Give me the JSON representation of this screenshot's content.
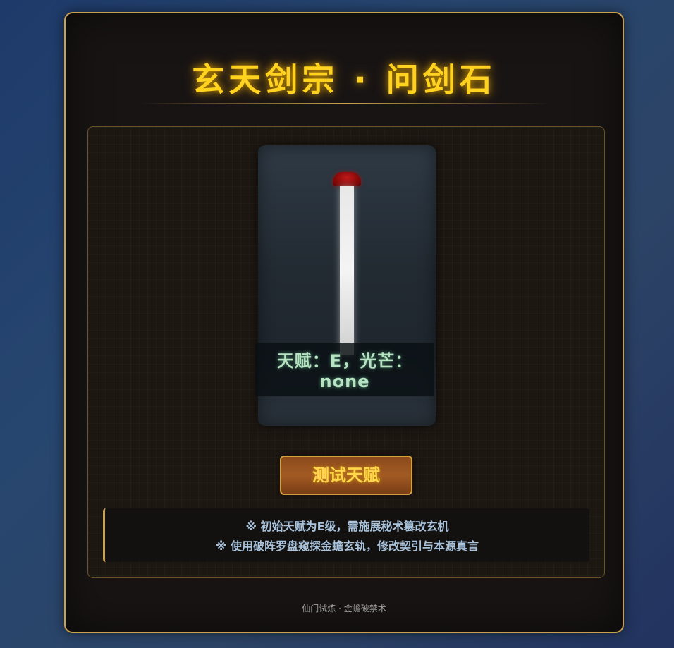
{
  "header": {
    "title": "玄天剑宗 · 问剑石"
  },
  "stone": {
    "readout_line1": "天赋：E，光芒：",
    "readout_line2": "none"
  },
  "actions": {
    "test_button_label": "测试天赋"
  },
  "notes": {
    "line1": "※ 初始天赋为E级，需施展秘术篡改玄机",
    "line2": "※ 使用破阵罗盘窥探金蟾玄轨，修改契引与本源真言"
  },
  "footer": {
    "text": "仙门试炼 · 金蟾破禁术"
  },
  "colors": {
    "accent_gold": "#c9a24f",
    "title_yellow": "#ffd21f",
    "readout_green": "#b8e3c2",
    "sword_guard_red": "#8a0a0a"
  }
}
